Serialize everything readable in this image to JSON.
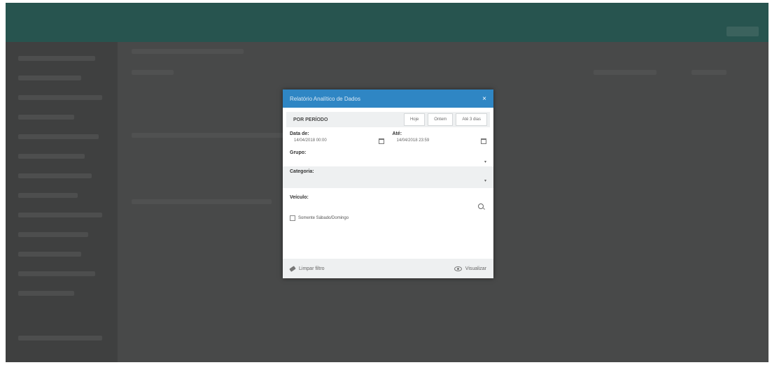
{
  "modal": {
    "title": "Relatório Analítico de Dados",
    "close_label": "×",
    "period": {
      "label": "POR PERÍODO",
      "buttons": [
        "Hoje",
        "Ontem",
        "Até 3 dias"
      ]
    },
    "date_from": {
      "label": "Data de:",
      "value": "14/04/2018 00:00"
    },
    "date_to": {
      "label": "Até:",
      "value": "14/04/2018 23:59"
    },
    "group": {
      "label": "Grupo:",
      "value": ""
    },
    "category": {
      "label": "Categoria:",
      "value": ""
    },
    "vehicle": {
      "label": "Veículo:",
      "value": ""
    },
    "weekend_checkbox": {
      "label": "Somente Sábado/Domingo",
      "checked": false
    },
    "clear_button": "Limpar filtro",
    "view_button": "Visualizar"
  },
  "colors": {
    "header": "#2f86c4",
    "topbar": "#275c56",
    "backdrop": "#4d4e4e"
  }
}
